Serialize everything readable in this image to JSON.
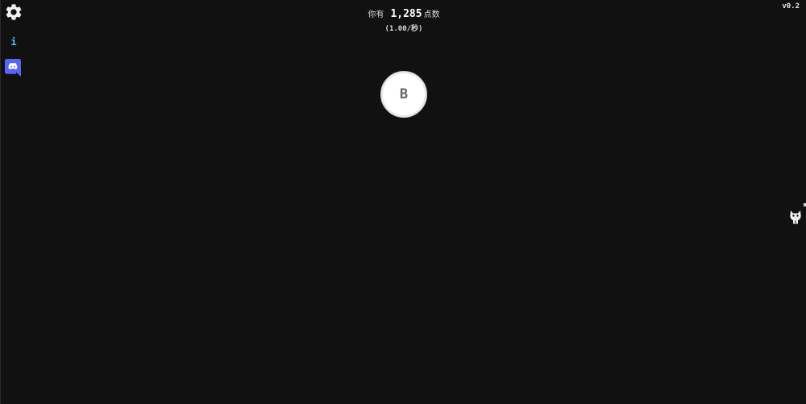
{
  "sidebar": {
    "settings_icon": "gear-icon",
    "info_icon": "info-icon",
    "discord_icon": "discord-icon",
    "info_glyph": "i"
  },
  "header": {
    "prefix": "你有",
    "amount": "1,285",
    "suffix": "点数",
    "rate": "(1.00/秒)"
  },
  "version": "v0.2",
  "main_button": {
    "label": "B"
  },
  "corner_icon": "github-cat-icon",
  "colors": {
    "background": "#111111",
    "info_accent": "#4fc3f7",
    "discord_accent": "#5865f2",
    "button_fill": "#ffffff"
  }
}
